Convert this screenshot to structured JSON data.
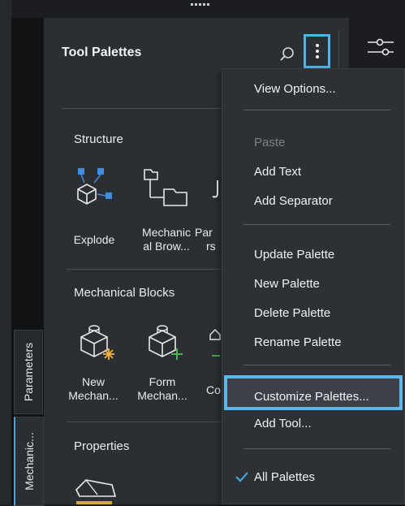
{
  "header": {
    "title": "Tool Palettes"
  },
  "side_tabs": {
    "parameters": "Parameters",
    "mechanical": "Mechanic..."
  },
  "sections": {
    "structure": {
      "title": "Structure",
      "tools": [
        {
          "label_line1": "Explode",
          "label_line2": ""
        },
        {
          "label_line1": "Mechanic",
          "label_line2": "al Brow..."
        },
        {
          "label_line1": "Par",
          "label_line2": "rs"
        }
      ]
    },
    "mechanical_blocks": {
      "title": "Mechanical Blocks",
      "tools": [
        {
          "label_line1": "New",
          "label_line2": "Mechan..."
        },
        {
          "label_line1": "Form",
          "label_line2": "Mechan..."
        },
        {
          "label_line1": "Co",
          "label_line2": ""
        }
      ]
    },
    "properties": {
      "title": "Properties"
    }
  },
  "menu": {
    "items": [
      {
        "label": "View Options..."
      },
      {
        "label": "Paste"
      },
      {
        "label": "Add Text"
      },
      {
        "label": "Add Separator"
      },
      {
        "label": "Update Palette"
      },
      {
        "label": "New Palette"
      },
      {
        "label": "Delete Palette"
      },
      {
        "label": "Rename Palette"
      },
      {
        "label": "Customize Palettes..."
      },
      {
        "label": "Add Tool..."
      },
      {
        "label": "All Palettes"
      }
    ]
  },
  "colors": {
    "accent": "#4fb3e8",
    "panel": "#2b2e33",
    "menu": "#2d3035"
  }
}
